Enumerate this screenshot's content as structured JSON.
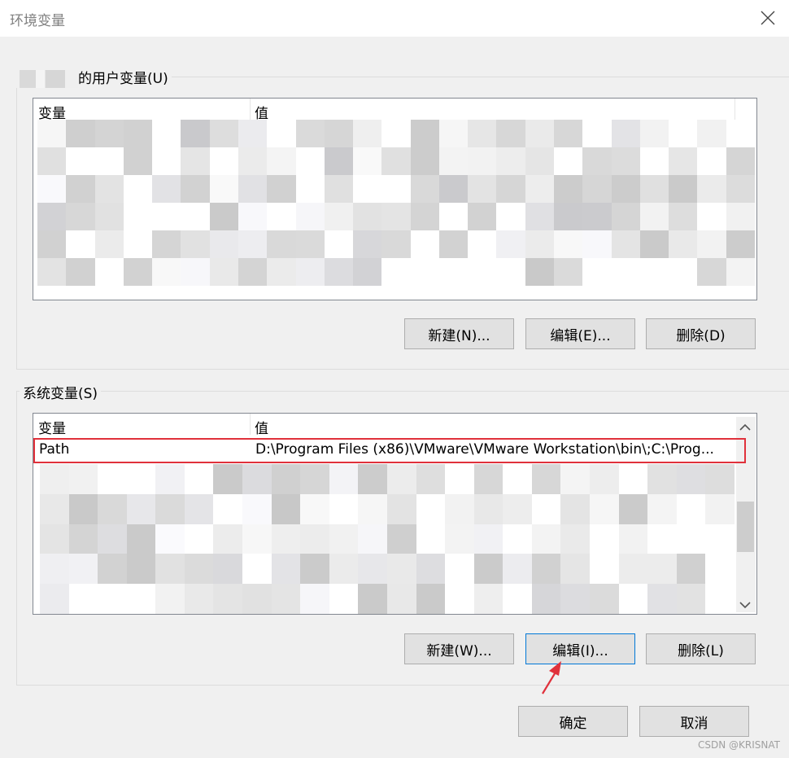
{
  "window": {
    "title": "环境变量"
  },
  "user_vars": {
    "group_label": "的用户变量(U)",
    "columns": {
      "name": "变量",
      "value": "值"
    },
    "buttons": {
      "new": "新建(N)...",
      "edit": "编辑(E)...",
      "delete": "删除(D)"
    }
  },
  "system_vars": {
    "group_label": "系统变量(S)",
    "columns": {
      "name": "变量",
      "value": "值"
    },
    "rows": [
      {
        "name": "Path",
        "value": "D:\\Program Files (x86)\\VMware\\VMware Workstation\\bin\\;C:\\Prog..."
      }
    ],
    "buttons": {
      "new": "新建(W)...",
      "edit": "编辑(I)...",
      "delete": "删除(L)"
    }
  },
  "footer": {
    "ok": "确定",
    "cancel": "取消"
  },
  "watermark": "CSDN @KRISNAT",
  "colors": {
    "highlight": "#e0313b",
    "arrow": "#e0313b",
    "focus_border": "#0078d7"
  },
  "icons": {
    "close": "close-icon",
    "scroll_up": "chevron-up-icon",
    "scroll_down": "chevron-down-icon",
    "annotation": "arrow-icon"
  }
}
